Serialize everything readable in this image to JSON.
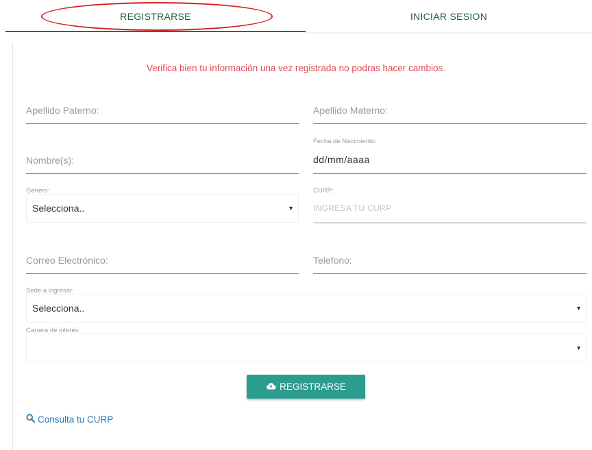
{
  "tabs": {
    "register": "REGISTRARSE",
    "login": "INICIAR SESION"
  },
  "form": {
    "warning": "Verifica bien tu información una vez registrada no podras hacer cambios.",
    "apellido_paterno": {
      "placeholder": "Apellido Paterno:"
    },
    "apellido_materno": {
      "placeholder": "Apellido Materno:"
    },
    "nombre": {
      "placeholder": "Nombre(s):"
    },
    "fecha_nacimiento": {
      "label": "Fecha de Nacimiento:",
      "value": "dd/mm/aaaa"
    },
    "genero": {
      "label": "Genero:",
      "selected": "Selecciona.."
    },
    "curp": {
      "label": "CURP:",
      "placeholder": "INGRESA TU CURP"
    },
    "correo": {
      "placeholder": "Correo Electrónico:"
    },
    "telefono": {
      "placeholder": "Telefono:"
    },
    "sede": {
      "label": "Sede a ingresar:",
      "selected": "Selecciona.."
    },
    "carrera": {
      "label": "Carrera de interés:",
      "selected": ""
    },
    "submit_label": "REGISTRARSE",
    "curp_link": "Consulta tu CURP"
  },
  "icons": {
    "submit": "cloud-upload-icon",
    "curp_link": "search-icon",
    "select_caret": "caret-down-icon"
  },
  "colors": {
    "brand_green": "#1b5e3a",
    "warning_red": "#e0454b",
    "button_teal": "#2a9d8f",
    "link_blue": "#2d7db3",
    "annotation_red": "#d42020"
  }
}
